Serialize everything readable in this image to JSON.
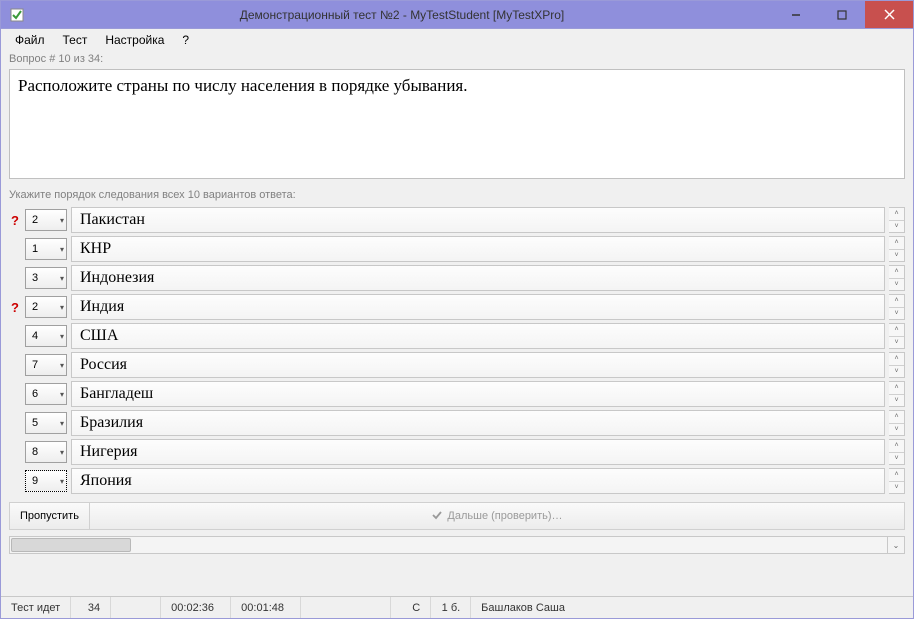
{
  "window": {
    "title": "Демонстрационный тест №2 - MyTestStudent [MyTestXPro]"
  },
  "menu": {
    "file": "Файл",
    "test": "Тест",
    "settings": "Настройка",
    "help": "?"
  },
  "progress": "Вопрос # 10 из 34:",
  "question": "Расположите страны по числу населения в порядке убывания.",
  "instruction": "Укажите порядок следования всех 10 вариантов ответа:",
  "answers": [
    {
      "warn": "?",
      "order": "2",
      "text": "Пакистан",
      "active": false
    },
    {
      "warn": "",
      "order": "1",
      "text": "КНР",
      "active": false
    },
    {
      "warn": "",
      "order": "3",
      "text": "Индонезия",
      "active": false
    },
    {
      "warn": "?",
      "order": "2",
      "text": "Индия",
      "active": false
    },
    {
      "warn": "",
      "order": "4",
      "text": "США",
      "active": false
    },
    {
      "warn": "",
      "order": "7",
      "text": "Россия",
      "active": false
    },
    {
      "warn": "",
      "order": "6",
      "text": "Бангладеш",
      "active": false
    },
    {
      "warn": "",
      "order": "5",
      "text": "Бразилия",
      "active": false
    },
    {
      "warn": "",
      "order": "8",
      "text": "Нигерия",
      "active": false
    },
    {
      "warn": "",
      "order": "9",
      "text": "Япония",
      "active": true
    }
  ],
  "buttons": {
    "skip": "Пропустить",
    "next": "Дальше (проверить)…"
  },
  "status": {
    "state": "Тест идет",
    "total": "34",
    "time1": "00:02:36",
    "time2": "00:01:48",
    "mode": "С",
    "score": "1 б.",
    "user": "Башлаков Саша"
  }
}
